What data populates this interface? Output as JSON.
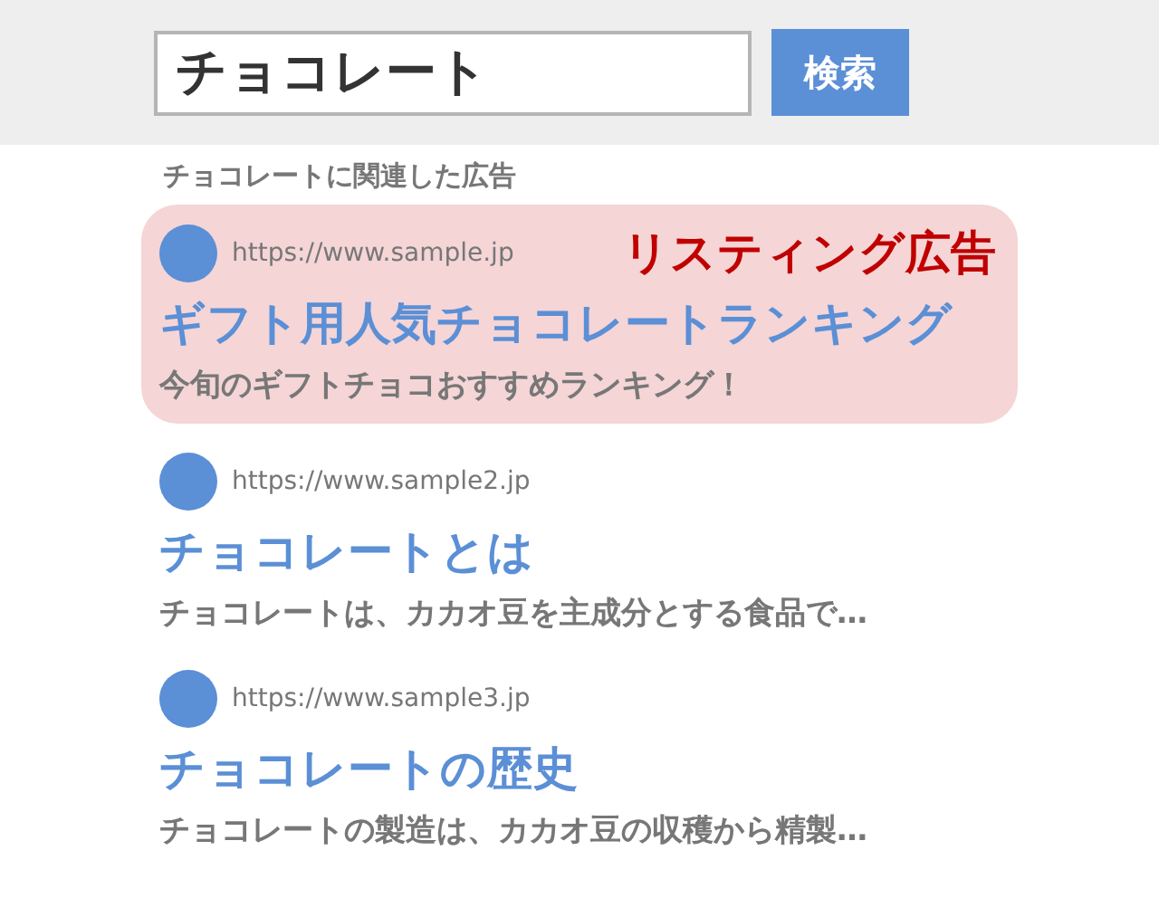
{
  "search": {
    "query": "チョコレート",
    "button": "検索"
  },
  "ads_heading": "チョコレートに関連した広告",
  "results": [
    {
      "kind": "ad",
      "url": "https://www.sample.jp",
      "label": "リスティング広告",
      "title": "ギフト用人気チョコレートランキング",
      "snippet": "今旬のギフトチョコおすすめランキング！"
    },
    {
      "kind": "organic",
      "url": "https://www.sample2.jp",
      "title": "チョコレートとは",
      "snippet": "チョコレートは、カカオ豆を主成分とする食品で…"
    },
    {
      "kind": "organic",
      "url": "https://www.sample3.jp",
      "title": "チョコレートの歴史",
      "snippet": "チョコレートの製造は、カカオ豆の収穫から精製…"
    }
  ]
}
